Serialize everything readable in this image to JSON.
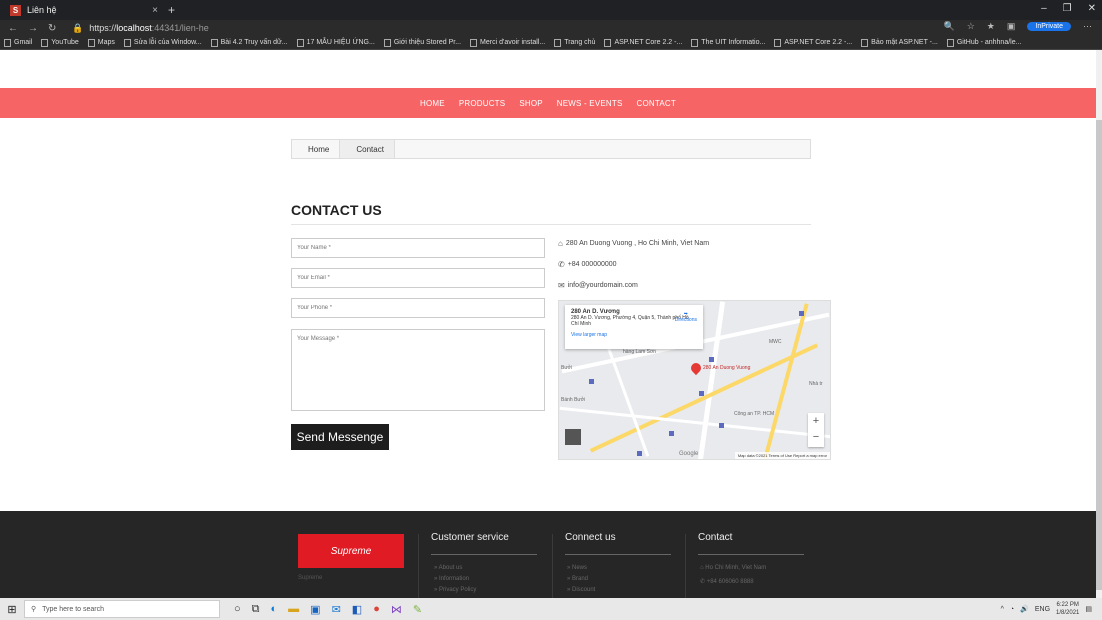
{
  "browser": {
    "tab_title": "Liên hệ",
    "tab_close": "×",
    "new_tab": "+",
    "url_protocol": "https://",
    "url_host": "localhost",
    "url_path": ":44341/lien-he",
    "inprivate": "InPrivate",
    "window_controls": [
      "–",
      "❐",
      "✕"
    ],
    "bookmarks": [
      "Gmail",
      "YouTube",
      "Maps",
      "Sửa lỗi của Window...",
      "Bài 4.2 Truy vấn dữ...",
      "17 MẪU HIỆU ỨNG...",
      "Giới thiệu Stored Pr...",
      "Merci d'avoir install...",
      "Trang chủ",
      "ASP.NET Core 2.2 -...",
      "The UIT Informatio...",
      "ASP.NET Core 2.2 -...",
      "Bảo mật ASP.NET -...",
      "GitHub - anhhna/le..."
    ]
  },
  "nav": {
    "items": [
      "HOME",
      "PRODUCTS",
      "SHOP",
      "NEWS - EVENTS",
      "CONTACT"
    ]
  },
  "breadcrumb": {
    "home": "Home",
    "current": "Contact"
  },
  "contact": {
    "title": "CONTACT US",
    "name_placeholder": "Your Name *",
    "email_placeholder": "Your Email *",
    "phone_placeholder": "Your Phone *",
    "message_placeholder": "Your Message *",
    "send_label": "Send Messenge",
    "address": "280 An Duong Vuong , Ho Chi Minh, Viet Nam",
    "phone": "+84 000000000",
    "email": "info@yourdomain.com"
  },
  "map": {
    "place_name": "280 An D. Vương",
    "place_address": "280 An D. Vương, Phường 4, Quận 5, Thành phố Hồ Chí Minh",
    "directions": "Directions",
    "larger_map": "View larger map",
    "pin_label": "280 An Duong Vuong",
    "label_mwc": "MWC",
    "label_hang_lam_son": "hàng Lam Sơn",
    "label_nha": "Nhà tr",
    "label_cong_an": "Công an TP. HCM",
    "label_anh_buoi": "Bưởi",
    "label_banh_buoi": "Bánh Bưởi",
    "google": "Google",
    "footer": "Map data ©2021   Terms of Use   Report a map error"
  },
  "footer": {
    "brand": "Supreme",
    "brand_caption": "Supreme",
    "col1_title": "Customer service",
    "col1_links": [
      "» About us",
      "» Information",
      "» Privacy Policy"
    ],
    "col2_title": "Connect us",
    "col2_links": [
      "» News",
      "» Brand",
      "» Discount"
    ],
    "col3_title": "Contact",
    "col3_lines": [
      "Ho Chi Minh, Viet Nam",
      "+84 606060 8888"
    ]
  },
  "taskbar": {
    "search_placeholder": "Type here to search",
    "language": "ENG",
    "time": "6:22 PM",
    "date": "1/8/2021"
  }
}
